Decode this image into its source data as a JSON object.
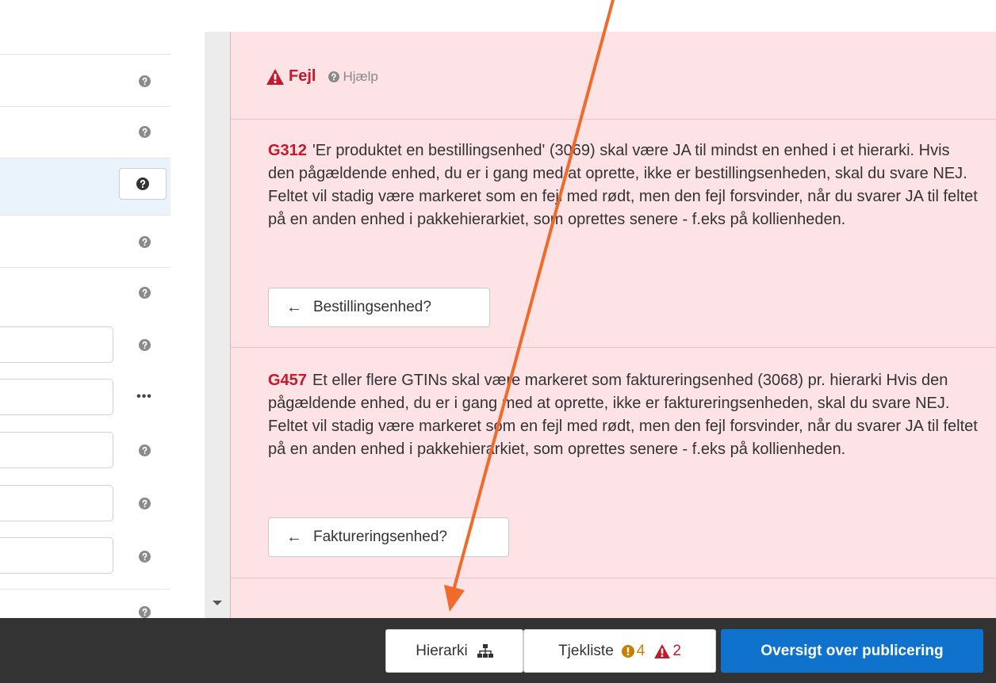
{
  "colors": {
    "error_red": "#c21a2b",
    "panel_bg": "#fde2e6",
    "warning_orange": "#c67f00",
    "primary_blue": "#0f72cc",
    "bottom_bar": "#333333",
    "annotation_arrow": "#f06a2a"
  },
  "error_panel": {
    "title": "Fejl",
    "help_label": "Hjælp",
    "errors": [
      {
        "code": "G312",
        "text": "'Er produktet en bestillingsenhed' (3069) skal være JA til mindst en enhed i et hierarki. Hvis den pågældende enhed, du er i gang med at oprette, ikke er bestillingsenheden, skal du svare NEJ. Feltet vil stadig være markeret som en fejl med rødt, men den fejl forsvinder, når du svarer JA til feltet på en anden enhed i pakkehierarkiet, som oprettes senere - f.eks på kollienheden.",
        "button_label": "Bestillingsenhed?"
      },
      {
        "code": "G457",
        "text": "Et eller flere GTINs skal være markeret som faktureringsenhed (3068) pr. hierarki Hvis den pågældende enhed, du er i gang med at oprette, ikke er faktureringsenheden, skal du svare NEJ. Feltet vil stadig være markeret som en fejl med rødt, men den fejl forsvinder, når du svarer JA til feltet på en anden enhed i pakkehierarkiet, som oprettes senere - f.eks på kollienheden.",
        "button_label": "Faktureringsenhed?"
      }
    ]
  },
  "bottom_bar": {
    "hierarchy_label": "Hierarki",
    "checklist_label": "Tjekliste",
    "warning_count": "4",
    "error_count": "2",
    "publish_overview_label": "Oversigt over publicering"
  },
  "left_panel": {
    "more_label": "•••"
  }
}
